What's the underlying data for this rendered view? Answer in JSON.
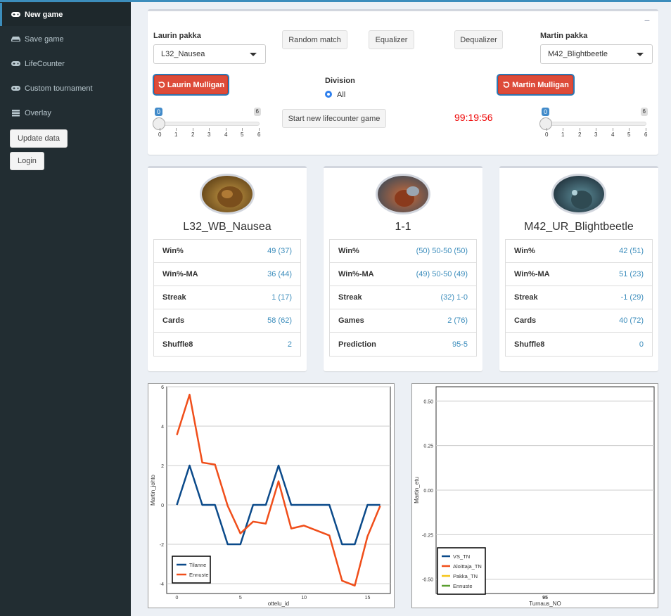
{
  "sidebar": {
    "items": [
      {
        "label": "New game",
        "icon": "gamepad-icon"
      },
      {
        "label": "Save game",
        "icon": "drive-icon"
      },
      {
        "label": "LifeCounter",
        "icon": "gamepad-icon"
      },
      {
        "label": "Custom tournament",
        "icon": "gamepad-icon"
      },
      {
        "label": "Overlay",
        "icon": "server-icon"
      }
    ],
    "update_label": "Update data",
    "login_label": "Login"
  },
  "controls": {
    "laurin_label": "Laurin pakka",
    "laurin_value": "L32_Nausea",
    "martin_label": "Martin pakka",
    "martin_value": "M42_Blightbeetle",
    "random_label": "Random match",
    "equalizer_label": "Equalizer",
    "dequalizer_label": "Dequalizer",
    "laurin_mulligan": "Laurin Mulligan",
    "martin_mulligan": "Martin Mulligan",
    "division_label": "Division",
    "division_option": "All",
    "start_label": "Start new lifecounter game",
    "timer": "99:19:56",
    "collapse": "−",
    "slider_left": {
      "min": "0",
      "max": "6",
      "ticks": [
        "0",
        "1",
        "2",
        "3",
        "4",
        "5",
        "6"
      ]
    },
    "slider_right": {
      "min": "0",
      "max": "6",
      "ticks": [
        "0",
        "1",
        "2",
        "3",
        "4",
        "5",
        "6"
      ]
    }
  },
  "cards": {
    "left": {
      "title": "L32_WB_Nausea",
      "rows": [
        {
          "k": "Win%",
          "v": "49 (37)"
        },
        {
          "k": "Win%-MA",
          "v": "36 (44)"
        },
        {
          "k": "Streak",
          "v": "1 (17)"
        },
        {
          "k": "Cards",
          "v": "58 (62)"
        },
        {
          "k": "Shuffle8",
          "v": "2"
        }
      ]
    },
    "mid": {
      "title": "1-1",
      "rows": [
        {
          "k": "Win%",
          "v": "(50) 50-50 (50)"
        },
        {
          "k": "Win%-MA",
          "v": "(49) 50-50 (49)"
        },
        {
          "k": "Streak",
          "v": "(32) 1-0"
        },
        {
          "k": "Games",
          "v": "2 (76)"
        },
        {
          "k": "Prediction",
          "v": "95-5"
        }
      ]
    },
    "right": {
      "title": "M42_UR_Blightbeetle",
      "rows": [
        {
          "k": "Win%",
          "v": "42 (51)"
        },
        {
          "k": "Win%-MA",
          "v": "51 (23)"
        },
        {
          "k": "Streak",
          "v": "-1 (29)"
        },
        {
          "k": "Cards",
          "v": "40 (72)"
        },
        {
          "k": "Shuffle8",
          "v": "0"
        }
      ]
    }
  },
  "chart_data": [
    {
      "type": "line",
      "xlabel": "ottelu_id",
      "ylabel": "Martin_johto",
      "xlim": [
        -0.8,
        16.8
      ],
      "ylim": [
        -4.5,
        6
      ],
      "xticks": [
        0,
        5,
        10,
        15
      ],
      "yticks": [
        6,
        4,
        2,
        0,
        -2,
        -4
      ],
      "grid": true,
      "legend_position": "bottom-left",
      "series": [
        {
          "name": "Tilanne",
          "color": "#0b4a8a",
          "x": [
            0,
            1,
            2,
            3,
            4,
            5,
            6,
            7,
            8,
            9,
            10,
            11,
            12,
            13,
            14,
            15,
            16
          ],
          "y": [
            0,
            2,
            0,
            0,
            -2,
            -2,
            0,
            0,
            2,
            0,
            0,
            0,
            0,
            -2,
            -2,
            0,
            0
          ]
        },
        {
          "name": "Ennuste",
          "color": "#f04e1a",
          "x": [
            0,
            1,
            2,
            3,
            4,
            5,
            6,
            7,
            8,
            9,
            10,
            11,
            12,
            13,
            14,
            15,
            16
          ],
          "y": [
            3.55,
            5.6,
            2.15,
            2.05,
            -0.05,
            -1.45,
            -0.85,
            -0.95,
            1.2,
            -1.2,
            -1.05,
            -1.3,
            -1.55,
            -3.85,
            -4.1,
            -1.6,
            -0.05
          ]
        }
      ]
    },
    {
      "type": "line",
      "xlabel": "Turnaus_NO",
      "ylabel": "Martin_etu",
      "ylim": [
        -0.58,
        0.58
      ],
      "yticks": [
        "0.50",
        "0.25",
        "0.00",
        "-0.25",
        "-0.50"
      ],
      "xticks": [
        "95"
      ],
      "grid": true,
      "legend_position": "bottom-left",
      "series": [
        {
          "name": "VS_TN",
          "color": "#0b4a8a"
        },
        {
          "name": "Aloittaja_TN",
          "color": "#f04e1a"
        },
        {
          "name": "Pakka_TN",
          "color": "#f5c518"
        },
        {
          "name": "Ennuste",
          "color": "#5a9e2f"
        }
      ]
    }
  ]
}
